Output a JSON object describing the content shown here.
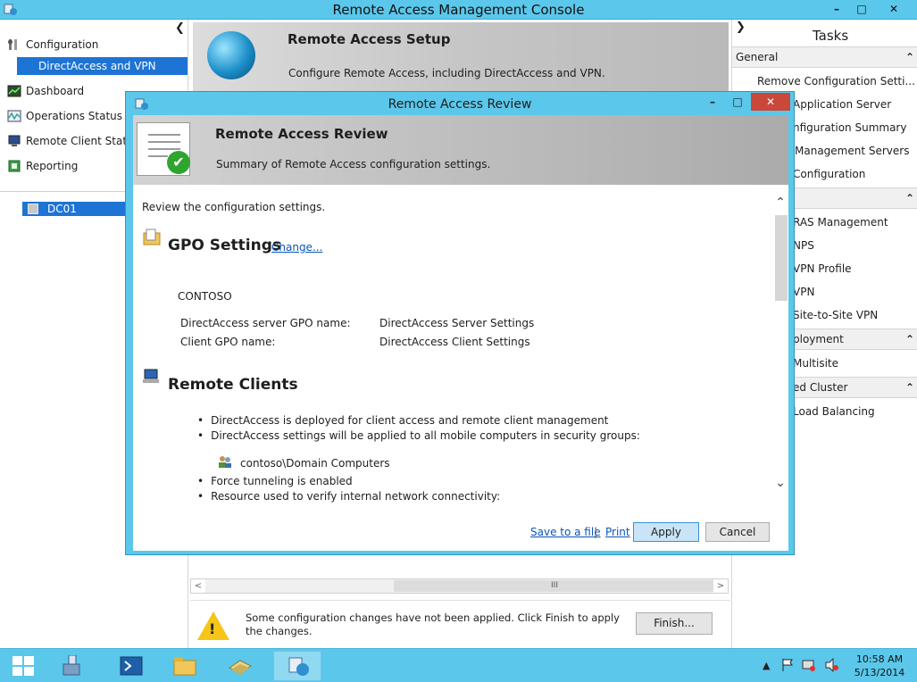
{
  "window": {
    "title": "Remote Access Management Console",
    "minimize": "–",
    "maximize": "□",
    "close": "✕"
  },
  "nav": {
    "collapse_glyph": "❮",
    "items": [
      {
        "label": "Configuration",
        "icon": "configuration-icon"
      },
      {
        "label": "DirectAccess and VPN",
        "icon": "none"
      },
      {
        "label": "Dashboard",
        "icon": "dashboard-icon"
      },
      {
        "label": "Operations Status",
        "icon": "operations-status-icon"
      },
      {
        "label": "Remote Client Status",
        "icon": "remote-client-status-icon"
      },
      {
        "label": "Reporting",
        "icon": "reporting-icon"
      }
    ],
    "server": "DC01"
  },
  "center": {
    "banner_title": "Remote Access Setup",
    "banner_sub": "Configure Remote Access, including DirectAccess and VPN.",
    "hscroll_left": "<",
    "hscroll_right": ">",
    "hscroll_grip": "III",
    "notice": "Some configuration changes have not been applied. Click Finish to apply the changes.",
    "finish_label": "Finish..."
  },
  "tasks": {
    "expand_glyph": "❯",
    "title": "Tasks",
    "groups": [
      {
        "header": "General",
        "items": [
          "Remove Configuration Setti...",
          "Application Server",
          "nfiguration Summary",
          "Management Servers",
          "Configuration"
        ]
      },
      {
        "header": "",
        "items": [
          "RAS Management",
          "NPS",
          "VPN Profile",
          "VPN",
          "Site-to-Site VPN"
        ]
      },
      {
        "header": "ployment",
        "items": [
          "Multisite"
        ]
      },
      {
        "header": "ed Cluster",
        "items": [
          "Load Balancing"
        ]
      }
    ],
    "chevron": "⌃"
  },
  "dialog": {
    "title": "Remote Access Review",
    "minimize": "–",
    "maximize": "□",
    "close": "✕",
    "header_title": "Remote Access Review",
    "header_sub": "Summary of Remote Access configuration settings.",
    "intro": "Review the configuration settings.",
    "gpo_title": "GPO Settings",
    "gpo_change": "Change...",
    "domain": "CONTOSO",
    "gpo_rows": [
      {
        "label": "DirectAccess server GPO name:",
        "value": "DirectAccess Server Settings"
      },
      {
        "label": "Client GPO name:",
        "value": "DirectAccess Client Settings"
      }
    ],
    "clients_title": "Remote Clients",
    "bullets_a": [
      "DirectAccess is deployed for client access and remote client management",
      "DirectAccess settings will be applied to all mobile computers in security groups:"
    ],
    "group": "contoso\\Domain Computers",
    "bullets_b": [
      "Force tunneling is enabled",
      "Resource used to verify internal network connectivity:"
    ],
    "scroll_up": "⌃",
    "scroll_down": "⌄",
    "save_link": "Save to a file",
    "separator": "|",
    "print_link": "Print",
    "apply_label": "Apply",
    "cancel_label": "Cancel"
  },
  "taskbar": {
    "apps": [
      "server-manager-icon",
      "powershell-icon",
      "file-explorer-icon",
      "tools-icon",
      "remote-access-icon"
    ],
    "tray_arrow": "▲",
    "time": "10:58 AM",
    "date": "5/13/2014"
  }
}
